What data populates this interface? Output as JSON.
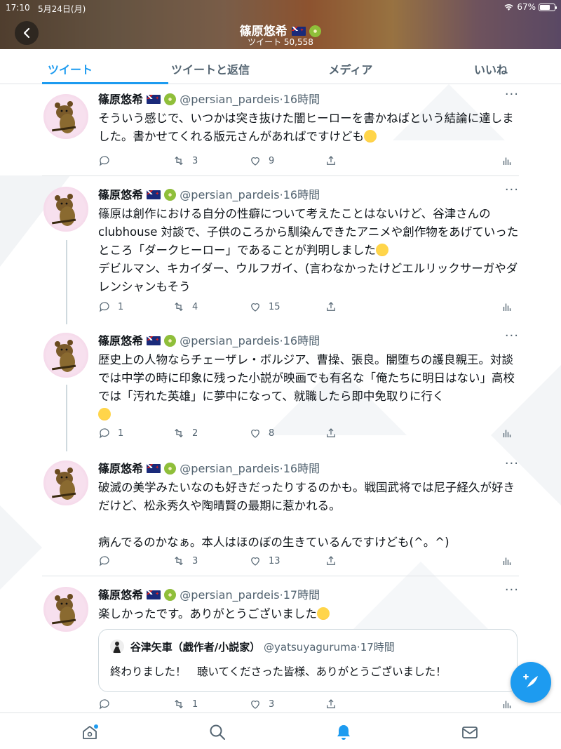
{
  "status_bar": {
    "time": "17:10",
    "date": "5月24日(月)",
    "battery": "67%"
  },
  "header": {
    "title": "篠原悠希",
    "tweet_count": "ツイート 50,558"
  },
  "tabs": [
    {
      "label": "ツイート",
      "active": true
    },
    {
      "label": "ツイートと返信",
      "active": false
    },
    {
      "label": "メディア",
      "active": false
    },
    {
      "label": "いいね",
      "active": false
    }
  ],
  "tweets": [
    {
      "name": "篠原悠希",
      "handle": "@persian_pardeis",
      "time": "16時間",
      "text": "そういう感じで、いつかは突き抜けた闇ヒーローを書かねばという結論に達しました。書かせてくれる版元さんがあればですけども",
      "replies": "",
      "retweets": "3",
      "likes": "9"
    },
    {
      "name": "篠原悠希",
      "handle": "@persian_pardeis",
      "time": "16時間",
      "text": "篠原は創作における自分の性癖について考えたことはないけど、谷津さんのclubhouse 対談で、子供のころから馴染んできたアニメや創作物をあげていったところ「ダークヒーロー」であることが判明しました",
      "text2": "デビルマン、キカイダー、ウルフガイ、(言わなかったけどエルリックサーガやダレンシャンもそう",
      "replies": "1",
      "retweets": "4",
      "likes": "15"
    },
    {
      "name": "篠原悠希",
      "handle": "@persian_pardeis",
      "time": "16時間",
      "text": "歴史上の人物ならチェーザレ・ボルジア、曹操、張良。闇堕ちの護良親王。対談では中学の時に印象に残った小説が映画でも有名な「俺たちに明日はない」高校では「汚れた英雄」に夢中になって、就職したら即中免取りに行く",
      "replies": "1",
      "retweets": "2",
      "likes": "8"
    },
    {
      "name": "篠原悠希",
      "handle": "@persian_pardeis",
      "time": "16時間",
      "text": "破滅の美学みたいなのも好きだったりするのかも。戦国武将では尼子経久が好きだけど、松永秀久や陶晴賢の最期に惹かれる。",
      "text2": "病んでるのかなぁ。本人はほのぼの生きているんですけども(^。^)",
      "replies": "",
      "retweets": "3",
      "likes": "13"
    },
    {
      "name": "篠原悠希",
      "handle": "@persian_pardeis",
      "time": "17時間",
      "text": "楽しかったです。ありがとうございました",
      "replies": "",
      "retweets": "1",
      "likes": "3",
      "quote": {
        "name": "谷津矢車（戯作者/小説家）",
        "handle": "@yatsuyaguruma",
        "time": "17時間",
        "text": "終わりました！　聴いてくださった皆様、ありがとうございました！"
      }
    }
  ],
  "colors": {
    "accent": "#1d9bf0",
    "text": "#0f1419",
    "muted": "#536471",
    "border": "#dfe3e6"
  },
  "icons": {
    "nav": [
      "home-icon",
      "search-icon",
      "notifications-icon",
      "messages-icon"
    ],
    "actions": [
      "reply-icon",
      "retweet-icon",
      "like-icon",
      "share-icon",
      "analytics-icon"
    ]
  }
}
